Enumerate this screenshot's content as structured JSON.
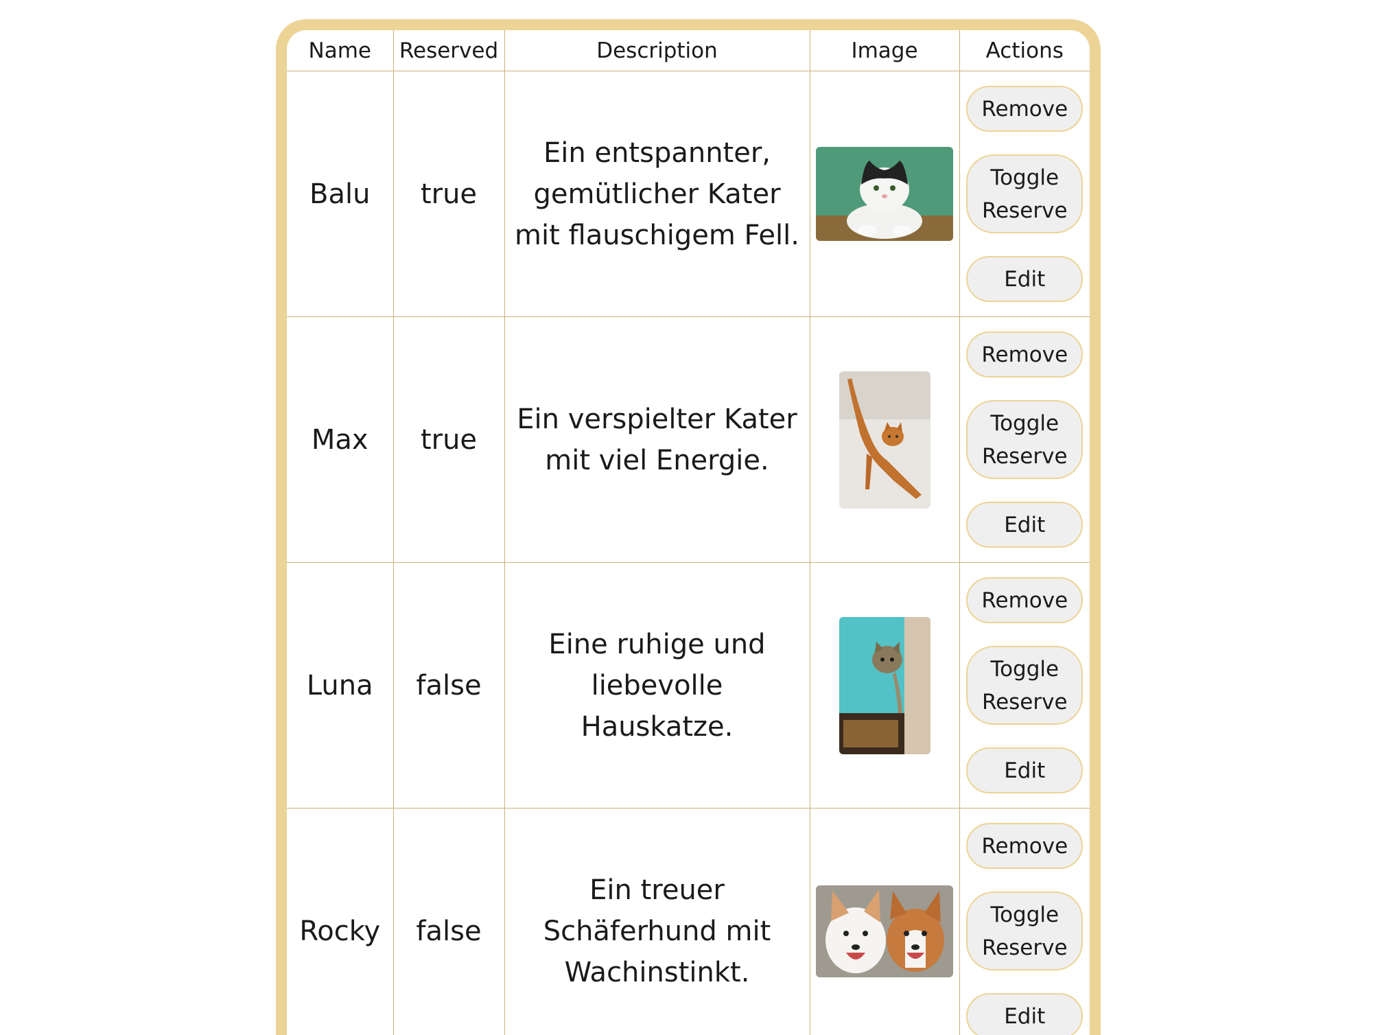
{
  "table": {
    "headers": [
      "Name",
      "Reserved",
      "Description",
      "Image",
      "Actions"
    ],
    "buttons": {
      "remove": "Remove",
      "toggle": "Toggle Reserve",
      "edit": "Edit"
    },
    "rows": [
      {
        "name": "Balu",
        "reserved": "true",
        "description": "Ein entspannter, gemütlicher Kater mit flauschigem Fell.",
        "image": "black-and-white-cat-photo"
      },
      {
        "name": "Max",
        "reserved": "true",
        "description": "Ein verspielter Kater mit viel Energie.",
        "image": "orange-cat-stretching-photo"
      },
      {
        "name": "Luna",
        "reserved": "false",
        "description": "Eine ruhige und liebevolle Hauskatze.",
        "image": "tabby-cat-peeking-photo"
      },
      {
        "name": "Rocky",
        "reserved": "false",
        "description": "Ein treuer Schäferhund mit Wachinstinkt.",
        "image": "two-corgi-dogs-photo"
      }
    ]
  },
  "colors": {
    "frame": "#ecd496",
    "grid": "#c9b37a",
    "button_bg": "#efefef"
  }
}
